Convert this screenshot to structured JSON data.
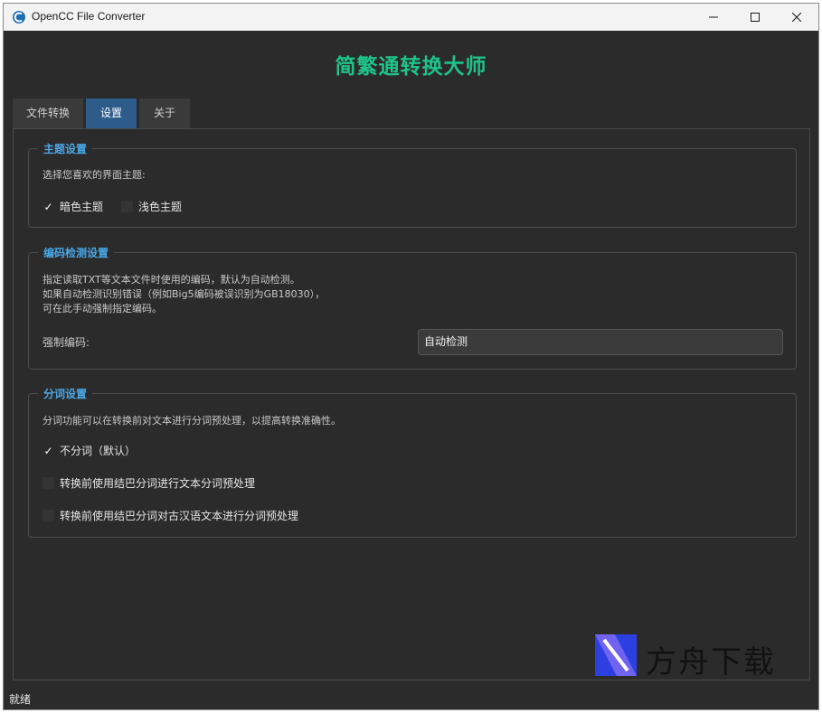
{
  "window": {
    "title": "OpenCC File Converter"
  },
  "app": {
    "heading": "简繁通转换大师"
  },
  "tabs": [
    {
      "label": "文件转换",
      "active": false
    },
    {
      "label": "设置",
      "active": true
    },
    {
      "label": "关于",
      "active": false
    }
  ],
  "theme_group": {
    "title": "主题设置",
    "prompt": "选择您喜欢的界面主题:",
    "options": [
      {
        "label": "暗色主题",
        "checked": true
      },
      {
        "label": "浅色主题",
        "checked": false
      }
    ]
  },
  "encoding_group": {
    "title": "编码检测设置",
    "desc_lines": [
      "指定读取TXT等文本文件时使用的编码，默认为自动检测。",
      "如果自动检测识别错误（例如Big5编码被误识别为GB18030），",
      "可在此手动强制指定编码。"
    ],
    "force_label": "强制编码:",
    "selected_encoding": "自动检测"
  },
  "segment_group": {
    "title": "分词设置",
    "desc": "分词功能可以在转换前对文本进行分词预处理，以提高转换准确性。",
    "options": [
      {
        "label": "不分词（默认）",
        "checked": true
      },
      {
        "label": "转换前使用结巴分词进行文本分词预处理",
        "checked": false
      },
      {
        "label": "转换前使用结巴分词对古汉语文本进行分词预处理",
        "checked": false
      }
    ]
  },
  "watermark": {
    "text": "方舟下载"
  },
  "status": {
    "text": "就绪"
  },
  "colors": {
    "accent_green": "#1fc38a",
    "group_title_blue": "#4aa8e8",
    "active_tab": "#2d5b8a",
    "background": "#2b2b2b"
  }
}
